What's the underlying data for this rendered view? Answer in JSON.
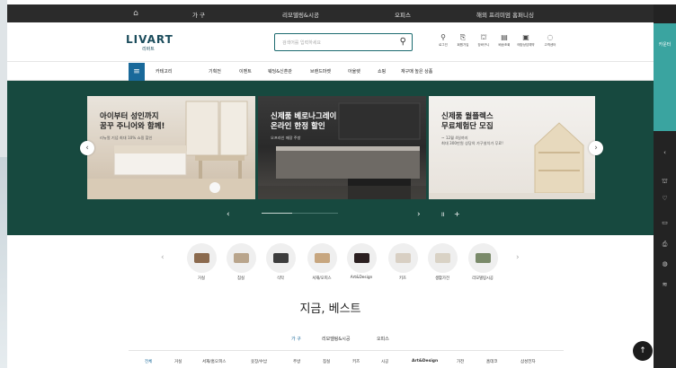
{
  "topbar": {
    "items": [
      "가 구",
      "리모델링&시공",
      "오피스",
      "해외 프리미엄 홈퍼니싱"
    ]
  },
  "header": {
    "logo": "LIVART",
    "logo_sub": "리바트",
    "search_placeholder": "검색어를 입력하세요",
    "utils": [
      {
        "icon": "user-icon",
        "glyph": "⚲",
        "label": "로그인"
      },
      {
        "icon": "join-icon",
        "glyph": "⎘",
        "label": "회원가입"
      },
      {
        "icon": "cart-icon",
        "glyph": "⛫",
        "label": "장바구니"
      },
      {
        "icon": "order-icon",
        "glyph": "▤",
        "label": "배송조회"
      },
      {
        "icon": "consult-icon",
        "glyph": "▣",
        "label": "매장상담예약"
      },
      {
        "icon": "service-icon",
        "glyph": "◌",
        "label": "고객센터"
      }
    ]
  },
  "nav": {
    "menu_label": "카테고리",
    "items": [
      "기획전",
      "이벤트",
      "웨딩&신혼관",
      "브랜드마켓",
      "아울렛",
      "쇼핑",
      "재구매 높은 상품"
    ]
  },
  "hero": {
    "cards": [
      {
        "title": "아이부터 성인까지\n꿈꾸 주니어와 함께!",
        "sub": "리뉴얼 기념 최대 10% 쇼핑 할인"
      },
      {
        "title": "신제품 베로나그레이\n온라인 한정 할인",
        "sub": "오프라인 매장 주방"
      },
      {
        "title": "신제품 월플렉스\n무료체험단 모집",
        "sub": "~ 12월 4일까지\n최대 300만원 상당의 가구설치가 무료!"
      }
    ],
    "prev": "‹",
    "next": "›",
    "pause": "II",
    "plus": "+",
    "progress": 0.4
  },
  "categories": {
    "items": [
      {
        "label": "거실",
        "color": "#8b6a4e"
      },
      {
        "label": "침실",
        "color": "#b9a58c"
      },
      {
        "label": "식탁",
        "color": "#3d3d3d"
      },
      {
        "label": "서재/오피스",
        "color": "#c7a67f"
      },
      {
        "label": "Art&Design",
        "color": "#2b1f20"
      },
      {
        "label": "키즈",
        "color": "#d8cfc3"
      },
      {
        "label": "생활가전",
        "color": "#d9d2c5"
      },
      {
        "label": "리모델링시공",
        "color": "#7a8a6a"
      }
    ]
  },
  "best": {
    "title": "지금, 베스트",
    "tabs": [
      "가 구",
      "리모델링&시공",
      "오피스"
    ],
    "sub_tabs": [
      "전체",
      "거실",
      "서재/홈오피스",
      "옷장/수납",
      "주방",
      "침실",
      "키즈",
      "시공",
      "Art&Design",
      "가전",
      "홈데코",
      "삼성전자"
    ]
  },
  "side": {
    "tab_label": "카운터",
    "icons": [
      "cart-icon",
      "heart-icon",
      "coupon-icon",
      "print-icon",
      "chat-icon",
      "list-icon"
    ]
  },
  "colors": {
    "hero_bg": "#17493f",
    "accent": "#3aa4a0",
    "nav_menu": "#19699a",
    "active_tab": "#19699a"
  }
}
